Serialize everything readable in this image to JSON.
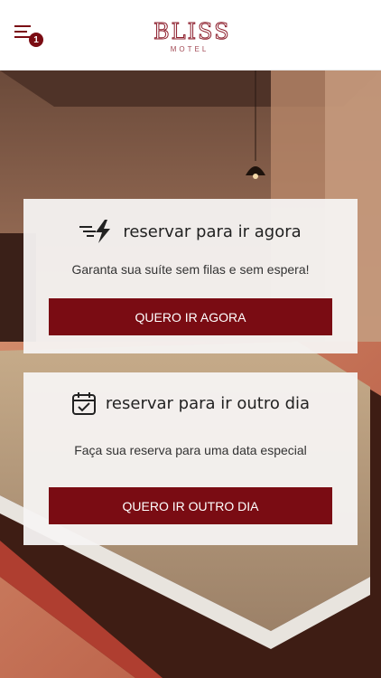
{
  "header": {
    "menu_icon": "hamburger-menu-icon",
    "badge_count": "1",
    "logo_word": "BLISS",
    "logo_sub": "MOTEL"
  },
  "colors": {
    "accent": "#7a0c13",
    "card_bg": "#f5f3f2",
    "header_bg": "#ffffff"
  },
  "cards": [
    {
      "icon": "fast-lightning-icon",
      "title": "reservar para ir agora",
      "description": "Garanta sua suíte sem filas e sem espera!",
      "button_label": "QUERO IR AGORA"
    },
    {
      "icon": "calendar-check-icon",
      "title": "reservar para ir outro dia",
      "description": "Faça sua reserva para uma data especial",
      "button_label": "QUERO IR OUTRO DIA"
    }
  ]
}
